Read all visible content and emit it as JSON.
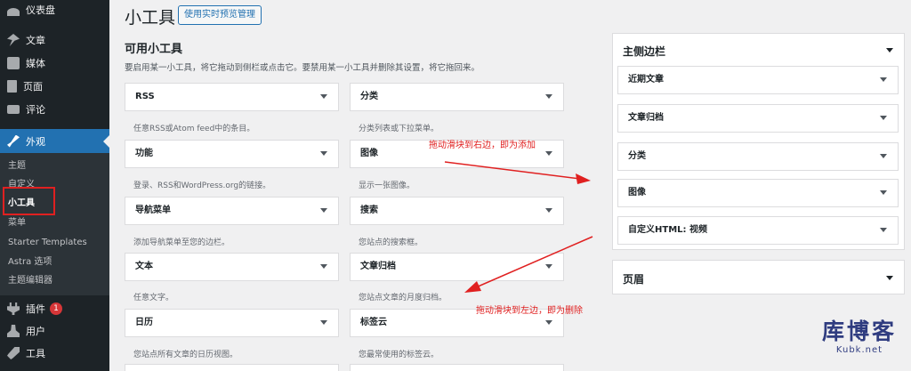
{
  "sidebar": {
    "items": [
      {
        "label": "仪表盘",
        "icon": "dashboard-icon"
      },
      {
        "label": "文章",
        "icon": "pin-icon"
      },
      {
        "label": "媒体",
        "icon": "media-icon"
      },
      {
        "label": "页面",
        "icon": "page-icon"
      },
      {
        "label": "评论",
        "icon": "comment-icon"
      },
      {
        "label": "外观",
        "icon": "brush-icon",
        "active": true
      },
      {
        "label": "插件",
        "icon": "plugin-icon",
        "badge": "1"
      },
      {
        "label": "用户",
        "icon": "user-icon"
      },
      {
        "label": "工具",
        "icon": "tool-icon"
      }
    ],
    "submenu": [
      "主题",
      "自定义",
      "小工具",
      "菜单",
      "Starter Templates",
      "Astra 选项",
      "主题编辑器"
    ],
    "current_sub": "小工具"
  },
  "header": {
    "title": "小工具",
    "preview_button": "使用实时预览管理"
  },
  "available": {
    "title": "可用小工具",
    "description": "要启用某一小工具，将它拖动到侧栏或点击它。要禁用某一小工具并删除其设置，将它拖回来。",
    "widgets": [
      {
        "name": "RSS",
        "desc": "任意RSS或Atom feed中的条目。"
      },
      {
        "name": "分类",
        "desc": "分类列表或下拉菜单。"
      },
      {
        "name": "功能",
        "desc": "登录、RSS和WordPress.org的链接。"
      },
      {
        "name": "图像",
        "desc": "显示一张图像。"
      },
      {
        "name": "导航菜单",
        "desc": "添加导航菜单至您的边栏。"
      },
      {
        "name": "搜索",
        "desc": "您站点的搜索框。"
      },
      {
        "name": "文本",
        "desc": "任意文字。"
      },
      {
        "name": "文章归档",
        "desc": "您站点文章的月度归档。"
      },
      {
        "name": "日历",
        "desc": "您站点所有文章的日历视图。"
      },
      {
        "name": "标签云",
        "desc": "您最常使用的标签云。"
      }
    ]
  },
  "areas": {
    "main_sidebar": {
      "title": "主侧边栏",
      "widgets": [
        "近期文章",
        "文章归档",
        "分类",
        "图像",
        "自定义HTML: 视频"
      ]
    },
    "header_area": {
      "title": "页眉"
    }
  },
  "annotations": {
    "add": "拖动滑块到右边，即为添加",
    "remove": "拖动滑块到左边，即为删除"
  },
  "watermark": {
    "main": "库博客",
    "sub": "Kubk.net"
  },
  "colors": {
    "sidebar_bg": "#1d2327",
    "active": "#2271b1",
    "annotation": "#e02020",
    "watermark": "#2f3c80"
  }
}
